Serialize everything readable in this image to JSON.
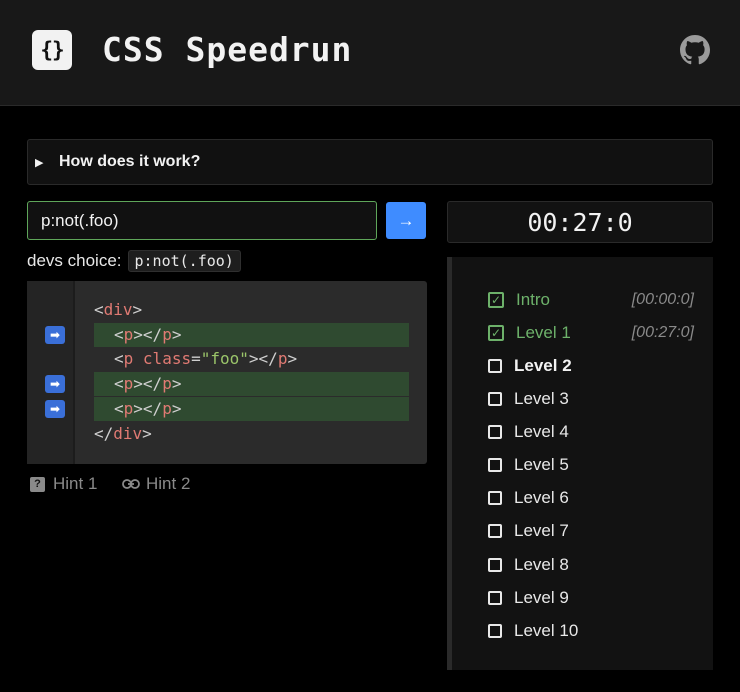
{
  "header": {
    "logo_glyph": "{}",
    "title": "CSS Speedrun",
    "github_icon": "github-icon"
  },
  "intro": {
    "toggle_glyph": "▶",
    "label": "How does it work?"
  },
  "editor": {
    "input_value": "p:not(.foo)",
    "submit_glyph": "→",
    "devs_choice_label": "devs choice:",
    "devs_choice_code": "p:not(.foo)"
  },
  "code": {
    "lines": [
      {
        "open": "<",
        "tag": "div",
        "close": ">"
      },
      {
        "open": "<",
        "tag": "p",
        "mid": "></",
        "tag2": "p",
        "close": ">"
      },
      {
        "open": "<",
        "tag": "p",
        "attr": "class",
        "eq": "=",
        "str": "\"foo\"",
        "mid": "></",
        "tag2": "p",
        "close": ">"
      },
      {
        "open": "<",
        "tag": "p",
        "mid": "></",
        "tag2": "p",
        "close": ">"
      },
      {
        "open": "<",
        "tag": "p",
        "mid": "></",
        "tag2": "p",
        "close": ">"
      },
      {
        "open": "</",
        "tag": "div",
        "close": ">"
      }
    ],
    "selected_marker": "➡"
  },
  "hints": [
    {
      "label": "Hint 1",
      "icon": "question-icon"
    },
    {
      "label": "Hint 2",
      "icon": "link-icon"
    }
  ],
  "timer": "00:27:0",
  "levels": [
    {
      "name": "Intro",
      "time": "[00:00:0]",
      "status": "done"
    },
    {
      "name": "Level 1",
      "time": "[00:27:0]",
      "status": "done"
    },
    {
      "name": "Level 2",
      "time": "",
      "status": "current"
    },
    {
      "name": "Level 3",
      "time": "",
      "status": "todo"
    },
    {
      "name": "Level 4",
      "time": "",
      "status": "todo"
    },
    {
      "name": "Level 5",
      "time": "",
      "status": "todo"
    },
    {
      "name": "Level 6",
      "time": "",
      "status": "todo"
    },
    {
      "name": "Level 7",
      "time": "",
      "status": "todo"
    },
    {
      "name": "Level 8",
      "time": "",
      "status": "todo"
    },
    {
      "name": "Level 9",
      "time": "",
      "status": "todo"
    },
    {
      "name": "Level 10",
      "time": "",
      "status": "todo"
    }
  ],
  "colors": {
    "accent_blue": "#3f8cff",
    "success_green": "#6db16a",
    "highlight_row": "#2f4a30"
  }
}
